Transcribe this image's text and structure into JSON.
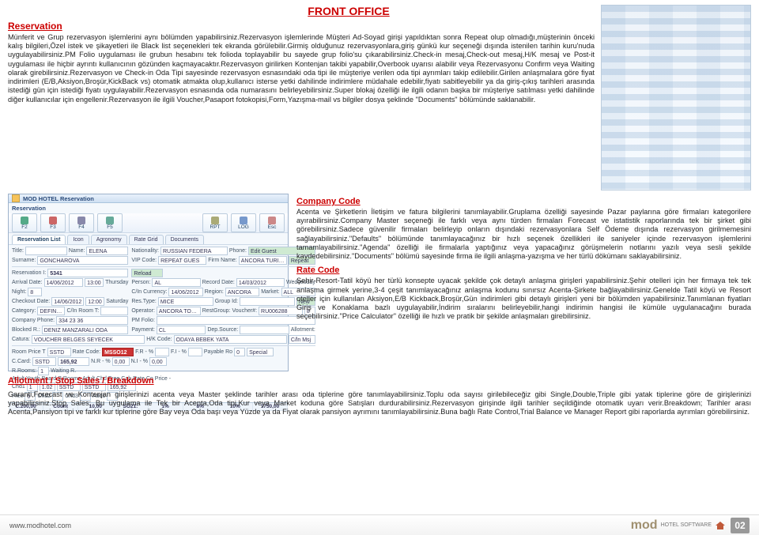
{
  "header": {
    "front_office": "FRONT OFFICE"
  },
  "reservation": {
    "hdg": "Reservation",
    "body": "Münferit ve Grup rezervasyon işlemlerini aynı bölümden yapabilirsiniz.Rezervasyon işlemlerinde Müşteri Ad-Soyad girişi yapıldıktan sonra Repeat olup olmadığı,müşterinin önceki kalış bilgileri,Özel istek ve şikayetleri ile Black list seçenekleri tek ekranda görülebilir.Girmiş olduğunuz rezervasyonlara,giriş günkü kur seçeneği dışında istenilen tarihin kuru'nuda uygulayabilirsiniz.PM Folio uygulaması ile grubun hesabını tek folioda toplayabilir bu sayede grup folio'su çıkarabilirsiniz.Check-in mesaj,Check-out mesaj,H/K mesaj ve Post-it uygulaması ile hiçbir ayrıntı kullanıcının gözünden kaçmayacaktır.Rezervasyon girilirken Kontenjan takibi yapabilir,Overbook uyarısı alabilir veya Rezervasyonu Confirm veya Waiting olarak girebilirsiniz.Rezervasyon ve Check-in Oda Tipi sayesinde rezervasyon esnasındaki oda tipi ile müşteriye verilen oda tipi ayrımları takip edilebilir.Girilen anlaşmalara göre fiyat indirimleri (E/B,Aksiyon,Broşür,KickBack vs) otomatik atmakta olup,kullanıcı isterse yetki dahilinde indirimlere müdahale edebilir,fiyatı sabitleyebilir ya da giriş-çıkış tarihleri arasında istediği gün için istediği fiyatı uygulayabilir.Rezervasyon esnasında oda numarasını belirleyebilirsiniz.Super blokaj özelliği ile ilgili odanın başka bir müşteriye satılması yetki dahilinde diğer kullanıcılar için engellenir.Rezervasyon ile ilgili Voucher,Pasaport fotokopisi,Form,Yazışma-mail vs bilgiler dosya şeklinde \"Documents\" bölümünde saklanabilir."
  },
  "win": {
    "title": "MOD HOTEL Reservation",
    "section": "Reservation",
    "fkeys": [
      "F2",
      "F3",
      "F4",
      "F5",
      "RPT",
      "LOG",
      "Esc"
    ],
    "tabs": [
      "Reservation List",
      "Icon",
      "Agronomy",
      "Rate Grid",
      "Documents"
    ],
    "fields": {
      "title_lbl": "Title:",
      "title_val": "",
      "name_lbl": "Name:",
      "name_val": "ELENA",
      "nationality_lbl": "Nationality:",
      "nationality_val": "RUSSIAN FEDERA",
      "phone_lbl": "Phone:",
      "edit_lbl": "Edit Guest",
      "surname_lbl": "Surname:",
      "surname_val": "GONCHAROVA",
      "vip_lbl": "VIP Code:",
      "vip_val": "REPEAT GUES",
      "firmname_lbl": "Firm Name:",
      "firmname_val": "ANCORA TURIZM",
      "repeat_lbl": "Repeat",
      "resvid_lbl": "Reservation I:",
      "resvid_val": "5341",
      "reload_lbl": "Reload",
      "arrival_lbl": "Arrival Date:",
      "arrival_val": "14/06/2012",
      "arrtime": "13:00",
      "thursday": "Thursday",
      "person_lbl": "Person:",
      "person_val": "AL",
      "recdate_lbl": "Record Date:",
      "recdate_val": "14/03/2012",
      "wednesday": "Wednesday",
      "night_lbl": "Night:",
      "night_val": "8",
      "cin_lbl": "C/In Currency:",
      "cin_val": "14/06/2012",
      "region_lbl": "Region:",
      "region_val": "ANCORA",
      "market_lbl": "Market:",
      "market_val": "ALL",
      "checkout_lbl": "Checkout Date:",
      "checkout_val": "14/06/2012",
      "cotime": "12:00",
      "saturday": "Saturday",
      "restype_lbl": "Res.Type:",
      "restype_val": "MICE",
      "groupid_lbl": "Group Id:",
      "newbtn": "New",
      "category_lbl": "Category:",
      "category_val": "DEFINITE",
      "cinroom_lbl": "C/In Room T:",
      "operator_lbl": "Operator:",
      "operator_val": "ANCORA TOUR. TİC",
      "restgrp_lbl": "RestGroup:",
      "voucher_lbl": "Voucher#:",
      "voucher_val": "RU006288",
      "cro_val": "8",
      "compphone_lbl": "Company Phone:",
      "compphone_val": "334 23 36",
      "pmfolio_lbl": "PM Folio:",
      "blockedr_lbl": "Blocked R.:",
      "blockedr_val": "DENIZ MANZARALI ODA",
      "payment_lbl": "Payment:",
      "payment_val": "CL",
      "depsource_lbl": "Dep.Source:",
      "allotment_lbl": "Allotment:",
      "catura_lbl": "Catura:",
      "catura_val": "VOUCHER BELGES SEYECEK",
      "hkcode_lbl": "H/K Code:",
      "hkcode_val": "ODAYA BEBEK YATA",
      "cinmsj_lbl": "C/ln Msj",
      "roomprice_lbl": "Room Price T",
      "roompricet": "SSTD",
      "ratecode_lbl": "Rate Code:",
      "ratecode_val": "MSSO12",
      "fr_lbl": "F.R - %",
      "fi_lbl": "F.I - %",
      "payable_lbl": "Payable Ro",
      "fix": "0",
      "special_lbl": "Special",
      "ccard_lbl": "C.Card:",
      "ccard_val": "SSTD",
      "price": "165,92",
      "nr_lbl": "N.R - %",
      "n_lbl": "N.I - %",
      "nr_val": "0,00",
      "n_val": "0,00",
      "rrooms_lbl": "R.Rooms:",
      "rrooms_val": "1",
      "waitingr_lbl": "Waiting R.",
      "adult_lbl": "Adult",
      "youth_lbl": "Youth",
      "board_lbl": "Board",
      "brooms_lbl": "B.Rooms",
      "adultchd_lbl": "Adult Chd",
      "free_lbl": "Free",
      "cab_lbl": "Cab",
      "rateco_lbl": "Rate Co",
      "price2_lbl": "Price -",
      "chd_lbl": "Chd1",
      "chd2_lbl": "Chd2",
      "chd3_lbl": "Chd3",
      "adult_val": "1",
      "chd1_val": "1.02",
      "std_val": "SSTD",
      "sstd_val": "SSTD",
      "cabrate": "165,92",
      "free_val": "0",
      "add1_lbl": "Add1"
    },
    "footer": {
      "hdrs": [
        "C.200,00",
        "Count",
        "10,00",
        "SO21:",
        "1%",
        "8%",
        "10%",
        "1750,00"
      ]
    }
  },
  "company": {
    "hdg": "Company Code",
    "body": "Acenta ve Şirketlerin İletişim ve fatura bilgilerini tanımlayabilir.Gruplama özelliği sayesinde Pazar paylarına göre firmaları kategorilere ayırabilirsiniz.Company Master seçeneği ile farklı veya aynı türden firmaları Forecast ve istatistik raporlarında tek bir şirket gibi görebilirsiniz.Sadece güvenilir firmaları belirleyip onların dışındaki rezervasyonlara Self Ödeme dışında rezervasyon girilmemesini sağlayabilirsiniz.\"Defaults\" bölümünde tanımlayacağınız bir hızlı seçenek özellikleri ile saniyeler içinde rezervasyon işlemlerini tamamlayabilirsiniz.\"Agenda\" özelliği ile firmalarla yaptığınız veya yapacağınız görüşmelerin notlarını yazılı veya sesli şekilde kaydedebilirsiniz.\"Documents\" bölümü sayesinde firma ile ilgili anlaşma-yazışma ve her türlü dökümanı saklayabilirsiniz."
  },
  "rate": {
    "hdg": "Rate Code",
    "body": "Şehir-Resort-Tatil köyü her türlü konsepte uyacak şekilde çok detaylı anlaşma girişleri yapabilirsiniz.Şehir otelleri için her firmaya tek tek anlaşma girmek yerine,3-4 çeşit tanımlayacağınız anlaşma kodunu sınırsız Acenta-Şirkete bağlayabilirsiniz.Genelde Tatil köyü ve Resort oteller için kullanılan Aksiyon,E/B Kickback,Broşür,Gün indirimleri gibi detaylı girişleri yeni bir bölümden yapabilirsiniz.Tanımlanan fiyatları Giriş ve Konaklama bazlı uygulayabilir,İndirim sıralarını belirleyebilir,hangi indirimin hangisi ile kümüle uygulanacağını burada seçebilirsiniz.\"Price Calculator\" özelliği ile hızlı ve pratik bir şekilde anlaşmaları girebilirsiniz."
  },
  "allot": {
    "hdg": "Allotment / Stop Sales / Breakdown",
    "body": "Garanti,Forecast ve Kontenjan girişlerinizi acenta veya Master şeklinde tarihler arası oda tiplerine göre tanımlayabilirsiniz.Toplu oda sayısı girilebileceğiz gibi Single,Double,Triple gibi yatak tiplerine göre de girişlerinizi yapabilirsiniz.Stop Sales; Bu uygulama ile Tek bir Acenta,Oda tipi,Kur veya Market koduna göre Satışları durdurabilirsiniz.Rezervasyon girişinde ilgili tarihler seçildiğinde otomatik uyarı verir.Breakdown; Tarihler arası Acenta,Pansiyon tipi ve farklı kur tiplerine göre Bay veya Oda başı veya Yüzde ya da Fiyat olarak pansiyon ayrımını tanımlayabilirsiniz.Buna bağlı Rate Control,Trial Balance ve Manager Report gibi raporlarda ayrımları görebilirsiniz."
  },
  "footer": {
    "url": "www.modhotel.com",
    "brand_main": "mod",
    "brand_sub": "HOTEL SOFTWARE",
    "page": "02"
  }
}
